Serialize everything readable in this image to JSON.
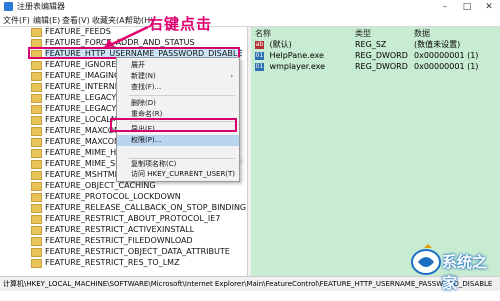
{
  "window": {
    "title": "注册表编辑器"
  },
  "menu": [
    "文件(F)",
    "编辑(E)",
    "查看(V)",
    "收藏夹(A)",
    "帮助(H)"
  ],
  "annotation": "右键点击",
  "tree": {
    "items": [
      "FEATURE_FEEDS",
      "FEATURE_FORCE_ADDR_AND_STATUS",
      "FEATURE_HTTP_USERNAME_PASSWORD_DISABLE",
      "FEATURE_IGNORE_",
      "FEATURE_IMAGING_",
      "FEATURE_INTERNET_",
      "FEATURE_LEGACY_",
      "FEATURE_LEGACY_",
      "FEATURE_LOCALM",
      "FEATURE_MAXCON",
      "FEATURE_MAXCON",
      "FEATURE_MIME_HANDLING",
      "FEATURE_MIME_SNIFFING",
      "FEATURE_MSHTML_AUTOLOAD_IEFRAME",
      "FEATURE_OBJECT_CACHING",
      "FEATURE_PROTOCOL_LOCKDOWN",
      "FEATURE_RELEASE_CALLBACK_ON_STOP_BINDING",
      "FEATURE_RESTRICT_ABOUT_PROTOCOL_IE7",
      "FEATURE_RESTRICT_ACTIVEXINSTALL",
      "FEATURE_RESTRICT_FILEDOWNLOAD",
      "FEATURE_RESTRICT_OBJECT_DATA_ATTRIBUTE",
      "FEATURE_RESTRICT_RES_TO_LMZ"
    ]
  },
  "columns": {
    "name": "名称",
    "type": "类型",
    "data": "数据"
  },
  "values": [
    {
      "name": "(默认)",
      "type": "REG_SZ",
      "data": "(数值未设置)",
      "icon": "string-value-icon"
    },
    {
      "name": "HelpPane.exe",
      "type": "REG_DWORD",
      "data": "0x00000001 (1)",
      "icon": "dword-value-icon"
    },
    {
      "name": "wmplayer.exe",
      "type": "REG_DWORD",
      "data": "0x00000001 (1)",
      "icon": "dword-value-icon"
    }
  ],
  "context_menu": {
    "items": [
      "展开",
      "新建(N)",
      "查找(F)...",
      "删除(D)",
      "重命名(R)",
      "导出(E)",
      "权限(P)...",
      "复制项名称(C)",
      "访问 HKEY_CURRENT_USER(T)"
    ],
    "new_arrow": "›"
  },
  "status": "计算机\\HKEY_LOCAL_MACHINE\\SOFTWARE\\Microsoft\\Internet Explorer\\Main\\FeatureControl\\FEATURE_HTTP_USERNAME_PASSWORD_DISABLE",
  "watermark": "系统之家",
  "colors": {
    "highlight": "#d6006f",
    "value_pane": "#c8ecd2",
    "selection": "#cce4f7"
  }
}
